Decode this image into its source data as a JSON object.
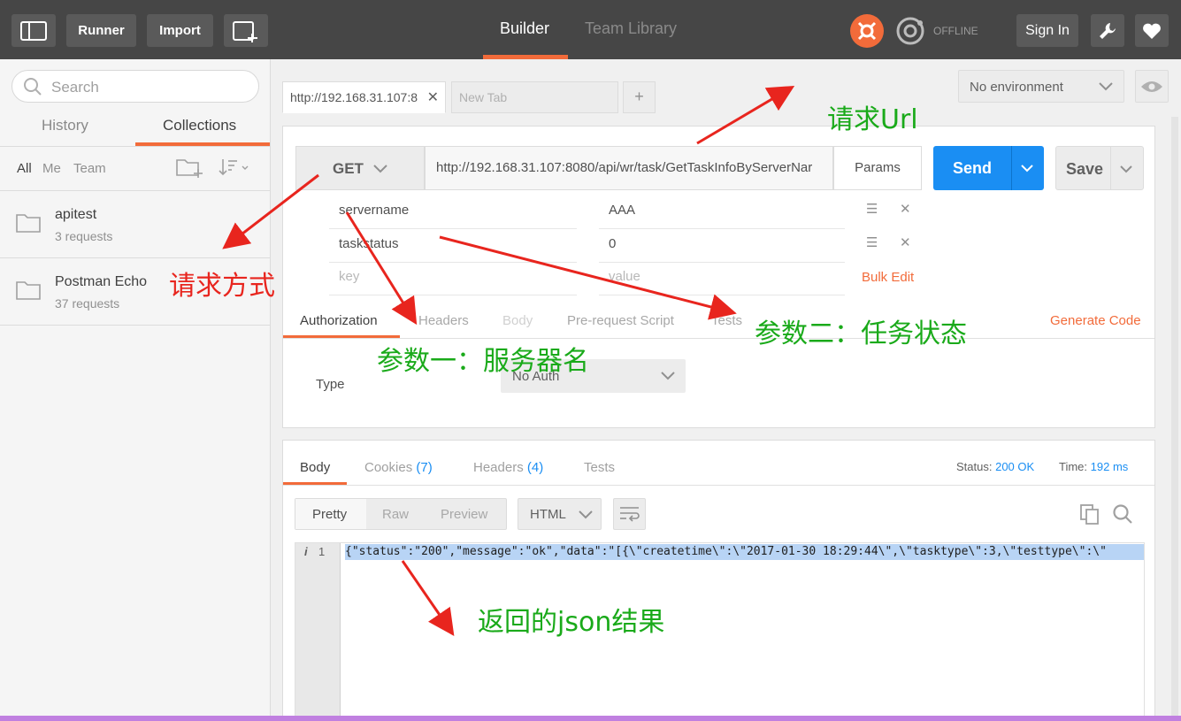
{
  "topbar": {
    "runner": "Runner",
    "import": "Import",
    "builder": "Builder",
    "team_library": "Team Library",
    "offline": "OFFLINE",
    "sign_in": "Sign In"
  },
  "sidebar": {
    "search_placeholder": "Search",
    "tabs": [
      "History",
      "Collections"
    ],
    "filters": [
      "All",
      "Me",
      "Team"
    ],
    "collections": [
      {
        "name": "apitest",
        "count": "3 requests"
      },
      {
        "name": "Postman Echo",
        "count": "37 requests"
      }
    ]
  },
  "request": {
    "tabs": [
      "http://192.168.31.107:8",
      "New Tab"
    ],
    "add_tab": "+",
    "environment": "No environment",
    "method": "GET",
    "url": "http://192.168.31.107:8080/api/wr/task/GetTaskInfoByServerNar",
    "params_label": "Params",
    "send_label": "Send",
    "save_label": "Save",
    "params": [
      {
        "key": "servername",
        "value": "AAA"
      },
      {
        "key": "taskstatus",
        "value": "0"
      }
    ],
    "key_placeholder": "key",
    "value_placeholder": "value",
    "bulk_edit": "Bulk Edit",
    "sub_tabs": [
      "Authorization",
      "Headers",
      "Body",
      "Pre-request Script",
      "Tests"
    ],
    "generate_code": "Generate Code",
    "auth_type_label": "Type",
    "auth_type_value": "No Auth"
  },
  "response": {
    "tabs": {
      "body": "Body",
      "cookies": "Cookies",
      "cookies_count": "(7)",
      "headers": "Headers",
      "headers_count": "(4)",
      "tests": "Tests"
    },
    "status_label": "Status:",
    "status_value": "200 OK",
    "time_label": "Time:",
    "time_value": "192 ms",
    "view_modes": [
      "Pretty",
      "Raw",
      "Preview"
    ],
    "format": "HTML",
    "line_info": "i",
    "line_number": "1",
    "body_line": "{\"status\":\"200\",\"message\":\"ok\",\"data\":\"[{\\\"createtime\\\":\\\"2017-01-30 18:29:44\\\",\\\"tasktype\\\":3,\\\"testtype\\\":\\\""
  },
  "annotations": {
    "url": "请求Url",
    "method": "请求方式",
    "param1": "参数一：服务器名",
    "param2": "参数二：任务状态",
    "result": "返回的json结果"
  },
  "colors": {
    "accent": "#f26b3a",
    "send": "#1a8ef3",
    "annotation_red": "#e8251e",
    "annotation_green": "#1aaa1a"
  }
}
